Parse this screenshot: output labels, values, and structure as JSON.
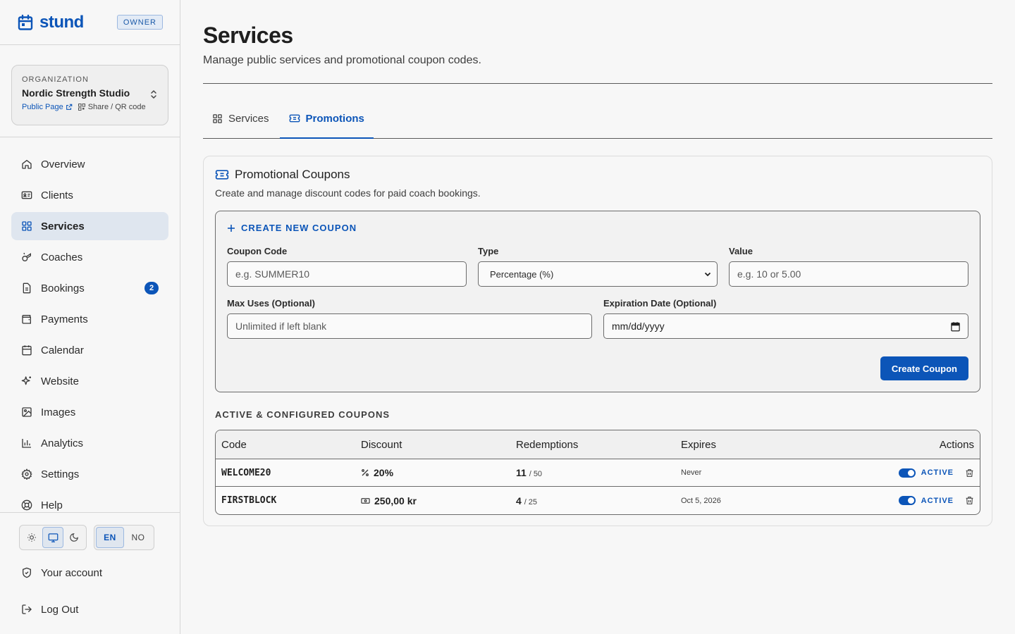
{
  "brand": {
    "name": "stund",
    "role_badge": "OWNER"
  },
  "organization": {
    "label": "ORGANIZATION",
    "name": "Nordic Strength Studio",
    "public_page": "Public Page",
    "share": "Share / QR code"
  },
  "nav": {
    "items": [
      {
        "label": "Overview",
        "icon": "home-icon"
      },
      {
        "label": "Clients",
        "icon": "id-card-icon"
      },
      {
        "label": "Services",
        "icon": "grid-icon",
        "active": true
      },
      {
        "label": "Coaches",
        "icon": "whistle-icon"
      },
      {
        "label": "Bookings",
        "icon": "document-icon",
        "badge": "2"
      },
      {
        "label": "Payments",
        "icon": "wallet-icon"
      },
      {
        "label": "Calendar",
        "icon": "calendar-icon"
      },
      {
        "label": "Website",
        "icon": "sparkles-icon"
      },
      {
        "label": "Images",
        "icon": "image-icon"
      },
      {
        "label": "Analytics",
        "icon": "bar-chart-icon"
      },
      {
        "label": "Settings",
        "icon": "gear-icon"
      },
      {
        "label": "Help",
        "icon": "lifebuoy-icon"
      }
    ]
  },
  "preferences": {
    "languages": [
      "EN",
      "NO"
    ],
    "active_language": "EN",
    "active_theme": "system"
  },
  "account": {
    "your_account": "Your account",
    "log_out": "Log Out"
  },
  "page": {
    "title": "Services",
    "subtitle": "Manage public services and promotional coupon codes."
  },
  "tabs": [
    {
      "label": "Services",
      "icon": "grid-icon"
    },
    {
      "label": "Promotions",
      "icon": "ticket-icon",
      "active": true
    }
  ],
  "coupons": {
    "title": "Promotional Coupons",
    "description": "Create and manage discount codes for paid coach bookings.",
    "form": {
      "heading": "CREATE NEW COUPON",
      "code_label": "Coupon Code",
      "code_placeholder": "e.g. SUMMER10",
      "type_label": "Type",
      "type_value": "Percentage (%)",
      "value_label": "Value",
      "value_placeholder": "e.g. 10 or 5.00",
      "max_label": "Max Uses (Optional)",
      "max_placeholder": "Unlimited if left blank",
      "exp_label": "Expiration Date (Optional)",
      "exp_placeholder": "mm/dd/yyyy",
      "submit": "Create Coupon"
    },
    "list_title": "ACTIVE & CONFIGURED COUPONS",
    "columns": [
      "Code",
      "Discount",
      "Redemptions",
      "Expires",
      "Actions"
    ],
    "rows": [
      {
        "code": "WELCOME20",
        "discount": "20%",
        "discount_icon": "percent-icon",
        "used": "11",
        "max": "/ 50",
        "expires": "Never",
        "status": "ACTIVE"
      },
      {
        "code": "FIRSTBLOCK",
        "discount": "250,00 kr",
        "discount_icon": "banknote-icon",
        "used": "4",
        "max": "/ 25",
        "expires": "Oct 5, 2026",
        "status": "ACTIVE"
      }
    ]
  },
  "colors": {
    "accent": "#0c55b8",
    "active_nav_bg": "#dfe6ef"
  }
}
